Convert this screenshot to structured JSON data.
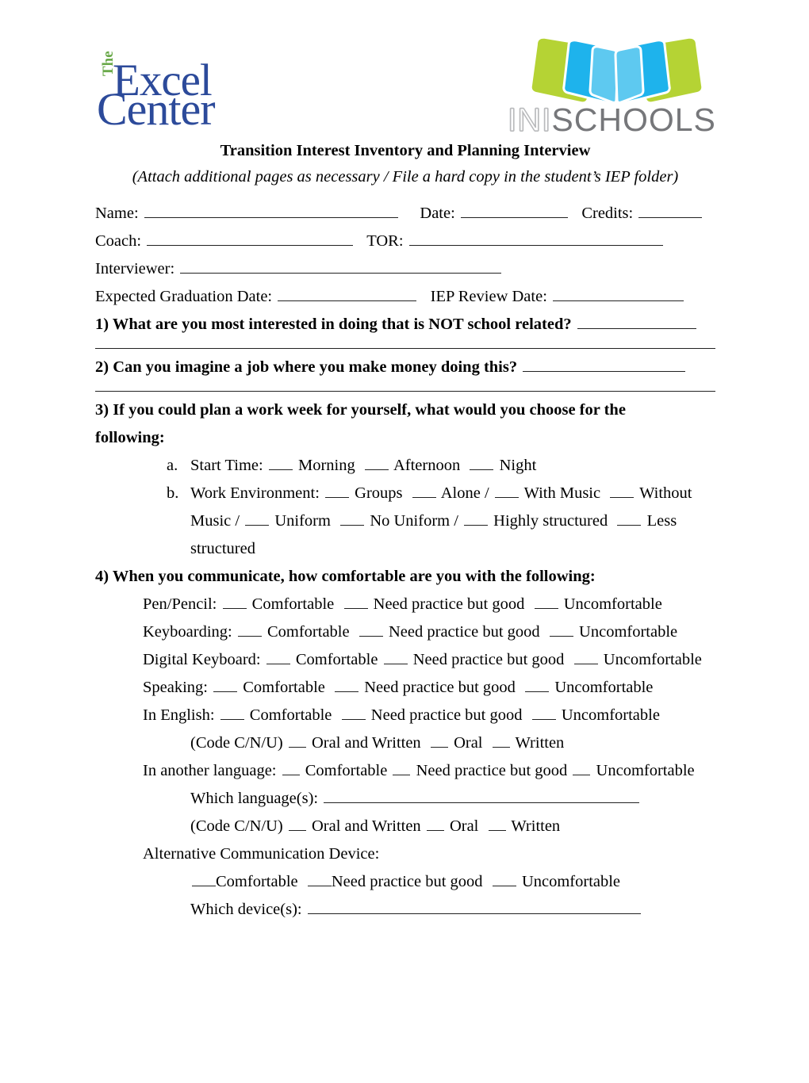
{
  "logos": {
    "excel_center": {
      "the": "The",
      "excel": "Excel",
      "center": "Center",
      "green": "#6aa94a",
      "blue": "#2c4a9a"
    },
    "ini_schools": {
      "ini": "INI",
      "schools": "SCHOOLS",
      "book_outer_color": "#b5d334",
      "book_mid_color": "#1eb3ec",
      "book_inner_color": "#5ec9f0",
      "text_color": "#76777a"
    }
  },
  "document": {
    "title": "Transition Interest Inventory and Planning Interview",
    "subtitle": "(Attach additional pages as necessary / File a hard copy in the student’s IEP folder)",
    "fields": {
      "name_label": "Name:",
      "date_label": "Date:",
      "credits_label": "Credits:",
      "coach_label": "Coach:",
      "tor_label": "TOR:",
      "interviewer_label": "Interviewer:",
      "expected_graduation_label": "Expected Graduation Date:",
      "iep_review_label": "IEP Review Date:"
    },
    "questions": {
      "q1": "1) What are you most interested in doing that is NOT school related?",
      "q2": "2) Can you imagine a job where you make money doing this?",
      "q3": "3) If you could plan a work week for yourself, what would you choose for the following:",
      "q3a_marker": "a.",
      "q3a_label": "Start Time:",
      "q3a_opt1": "Morning",
      "q3a_opt2": "Afternoon",
      "q3a_opt3": "Night",
      "q3b_marker": "b.",
      "q3b_label": "Work Environment:",
      "q3b_opt1": "Groups",
      "q3b_opt2": "Alone /",
      "q3b_opt3": "With Music",
      "q3b_opt4": "Without Music /",
      "q3b_opt5": "Uniform",
      "q3b_opt6": "No Uniform /",
      "q3b_opt7": "Highly structured",
      "q3b_opt8": "Less structured",
      "q4": "4) When you communicate, how comfortable are you with the following:",
      "opt_comfortable": "Comfortable",
      "opt_need_practice": "Need practice but good",
      "opt_uncomfortable": "Uncomfortable",
      "row_pen_pencil": "Pen/Pencil:",
      "row_keyboarding": "Keyboarding:",
      "row_digital_keyboard": "Digital Keyboard:",
      "row_speaking": "Speaking:",
      "row_in_english": "In English:",
      "code_label": "(Code C/N/U)",
      "code_opt1": "Oral and Written",
      "code_opt2": "Oral",
      "code_opt3": "Written",
      "row_another_language": "In another language:",
      "which_language_label": "Which language(s):",
      "alt_device_label": "Alternative Communication Device:",
      "which_device_label": "Which device(s):"
    }
  }
}
